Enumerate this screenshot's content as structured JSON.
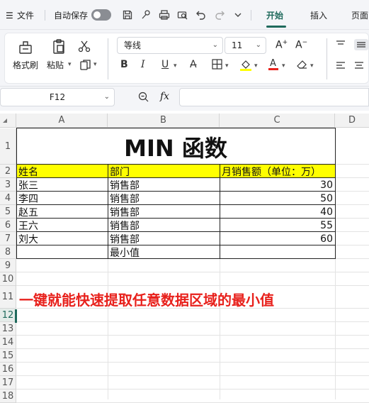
{
  "menu": {
    "app_menu_label": "文件",
    "autosave_label": "自动保存",
    "tabs": [
      "开始",
      "插入",
      "页面"
    ]
  },
  "ribbon": {
    "format_painter_label": "格式刷",
    "paste_label": "粘贴",
    "font_name": "等线",
    "font_size": "11",
    "bold": "B",
    "italic": "I",
    "underline": "U",
    "font_color_hex": "#e8211c",
    "fill_color_hex": "#ffff00"
  },
  "formula_bar": {
    "cell_ref": "F12",
    "fx_label": "fx",
    "content": ""
  },
  "sheet": {
    "columns": [
      "A",
      "B",
      "C",
      "D"
    ],
    "rows": [
      "1",
      "2",
      "3",
      "4",
      "5",
      "6",
      "7",
      "8",
      "9",
      "10",
      "11",
      "12",
      "13",
      "14",
      "15",
      "16",
      "17",
      "18"
    ],
    "active_row": "12",
    "title": "MIN 函数",
    "headers": {
      "a": "姓名",
      "b": "部门",
      "c": "月销售额（单位：万）"
    },
    "header_fill": "#ffff00",
    "data_rows": [
      {
        "name": "张三",
        "dept": "销售部",
        "sales": "30"
      },
      {
        "name": "李四",
        "dept": "销售部",
        "sales": "50"
      },
      {
        "name": "赵五",
        "dept": "销售部",
        "sales": "40"
      },
      {
        "name": "王六",
        "dept": "销售部",
        "sales": "55"
      },
      {
        "name": "刘大",
        "dept": "销售部",
        "sales": "60"
      }
    ],
    "min_label": "最小值",
    "min_value": "",
    "callout": "一键就能快速提取任意数据区域的最小值",
    "callout_color": "#e8211c"
  }
}
